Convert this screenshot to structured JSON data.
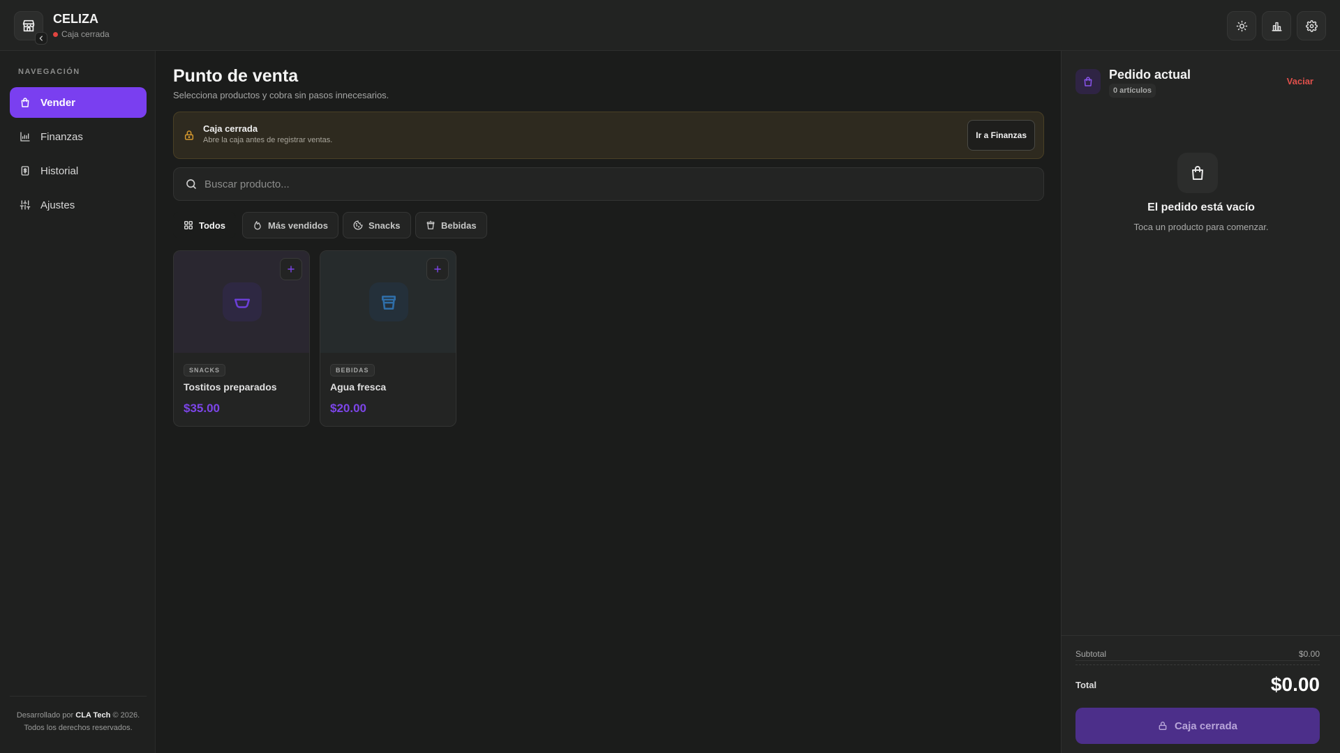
{
  "brand": {
    "name": "CELIZA",
    "status": "Caja cerrada"
  },
  "colors": {
    "accent": "#7a3ff0",
    "danger": "#e0504b",
    "warning": "#d79a2e",
    "price": "#7c45e8"
  },
  "header_actions": [
    {
      "icon": "sun-icon"
    },
    {
      "icon": "bar-chart-icon"
    },
    {
      "icon": "gear-icon"
    }
  ],
  "sidebar": {
    "heading": "NAVEGACIÓN",
    "items": [
      {
        "label": "Vender",
        "icon": "shopping-bag-icon",
        "active": true
      },
      {
        "label": "Finanzas",
        "icon": "chart-icon",
        "active": false
      },
      {
        "label": "Historial",
        "icon": "receipt-icon",
        "active": false
      },
      {
        "label": "Ajustes",
        "icon": "sliders-icon",
        "active": false
      }
    ],
    "footer": {
      "prefix": "Desarrollado por",
      "company": "CLA Tech",
      "suffix": "© 2026.",
      "rights": "Todos los derechos reservados."
    }
  },
  "main": {
    "title": "Punto de venta",
    "subtitle": "Selecciona productos y cobra sin pasos innecesarios.",
    "alert": {
      "title": "Caja cerrada",
      "text": "Abre la caja antes de registrar ventas.",
      "button": "Ir a Finanzas"
    },
    "search": {
      "placeholder": "Buscar producto...",
      "value": ""
    },
    "categories": [
      {
        "label": "Todos",
        "icon": "grid-icon",
        "active": true
      },
      {
        "label": "Más vendidos",
        "icon": "flame-icon",
        "active": false
      },
      {
        "label": "Snacks",
        "icon": "cookie-icon",
        "active": false
      },
      {
        "label": "Bebidas",
        "icon": "cup-icon",
        "active": false
      }
    ],
    "products": [
      {
        "category": "SNACKS",
        "name": "Tostitos preparados",
        "price": "$35.00",
        "icon": "bowl-icon"
      },
      {
        "category": "BEBIDAS",
        "name": "Agua fresca",
        "price": "$20.00",
        "icon": "cup-icon"
      }
    ]
  },
  "order": {
    "title": "Pedido actual",
    "count": "0 artículos",
    "clear": "Vaciar",
    "empty_title": "El pedido está vacío",
    "empty_text": "Toca un producto para comenzar.",
    "subtotal_label": "Subtotal",
    "subtotal_value": "$0.00",
    "total_label": "Total",
    "total_value": "$0.00",
    "checkout_label": "Caja cerrada"
  }
}
